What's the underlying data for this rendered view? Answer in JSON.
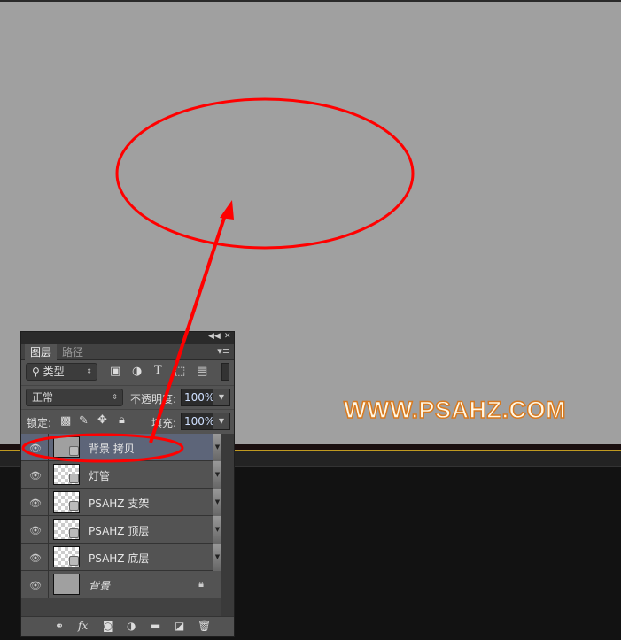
{
  "watermark": "WWW.PSAHZ.COM",
  "colors": {
    "canvas": "#a0a0a0",
    "annotation": "#ff0000",
    "watermark_stroke": "#d87a20",
    "selected_layer": "#5d6579"
  },
  "panel": {
    "header_icons": [
      "collapse-icon",
      "close-icon"
    ],
    "tabs": [
      {
        "label": "图层",
        "active": true
      },
      {
        "label": "路径",
        "active": false
      }
    ],
    "filter": {
      "kind": "类型"
    },
    "blend_mode": "正常",
    "opacity_label": "不透明度:",
    "opacity": "100%",
    "lock_label": "锁定:",
    "fill_label": "填充:",
    "fill": "100%",
    "layers": [
      {
        "name": "背景 拷贝",
        "selected": true,
        "visible": true
      },
      {
        "name": "灯管",
        "selected": false,
        "visible": true
      },
      {
        "name": "PSAHZ 支架",
        "selected": false,
        "visible": true
      },
      {
        "name": "PSAHZ 顶层",
        "selected": false,
        "visible": true
      },
      {
        "name": "PSAHZ 底层",
        "selected": false,
        "visible": true
      },
      {
        "name": "背景",
        "selected": false,
        "visible": true,
        "locked": true
      }
    ],
    "footer_fx": "fx"
  }
}
